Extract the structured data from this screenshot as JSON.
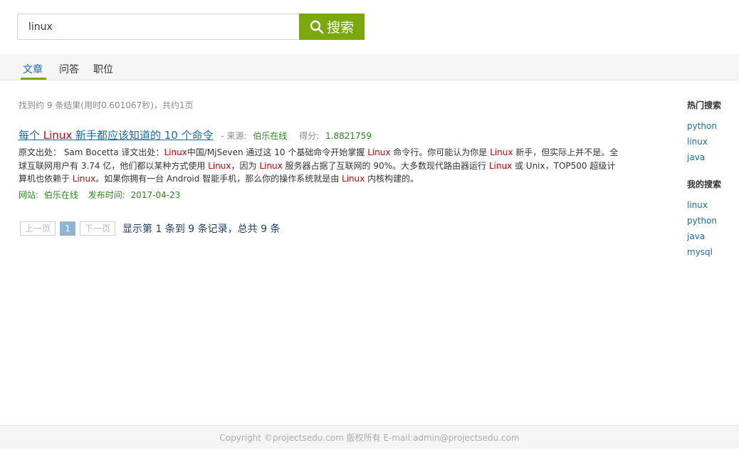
{
  "search": {
    "value": "linux",
    "button_label": "搜索"
  },
  "tabs": [
    {
      "label": "文章"
    },
    {
      "label": "问答"
    },
    {
      "label": "职位"
    }
  ],
  "stats": "找到约 9 条结果(用时0.601067秒)，共约1页",
  "result": {
    "title_parts": [
      "每个 ",
      "Linux",
      " 新手都应该知道的 10 个命令"
    ],
    "source_label": "- 来源:",
    "source_value": "伯乐在线",
    "score_label": "得分:",
    "score_value": "1.8821759",
    "snippet_parts": [
      "原文出处： Sam Bocetta   译文出处：",
      "Linux",
      "中国/MjSeven   通过这 10 个基础命令开始掌握 ",
      "Linux",
      " 命令行。你可能认为你是 ",
      "Linux",
      " 新手，但实际上并不是。全球互联网用户有 3.74 亿，他们都以某种方式使用 ",
      "Linux",
      "，因为 ",
      "Linux",
      " 服务器占据了互联网的 90%。大多数现代路由器运行 ",
      "Linux",
      " 或 Unix，TOP500 超级计算机也依赖于 ",
      "Linux",
      "。如果你拥有一台 Android 智能手机，那么你的操作系统就是由 ",
      "Linux",
      " 内核构建的。"
    ],
    "site_label": "网站:",
    "site_value": "伯乐在线",
    "date_label": "发布时间:",
    "date_value": "2017-04-23"
  },
  "pagination": {
    "prev_label": "上一页",
    "current_page": "1",
    "next_label": "下一页",
    "info": "显示第 1 条到 9 条记录，总共 9 条"
  },
  "sidebar": {
    "hot_title": "热门搜索",
    "hot_items": [
      "python",
      "linux",
      "java"
    ],
    "my_title": "我的搜索",
    "my_items": [
      "linux",
      "python",
      "java",
      "mysql"
    ]
  },
  "footer": "Copyright ©projectsedu.com 版权所有 E-mail:admin@projectsedu.com",
  "colors": {
    "accent": "#7ba90b",
    "link": "#1a6ba3",
    "highlight": "#cc0000",
    "meta_green": "#2a8a1c"
  }
}
